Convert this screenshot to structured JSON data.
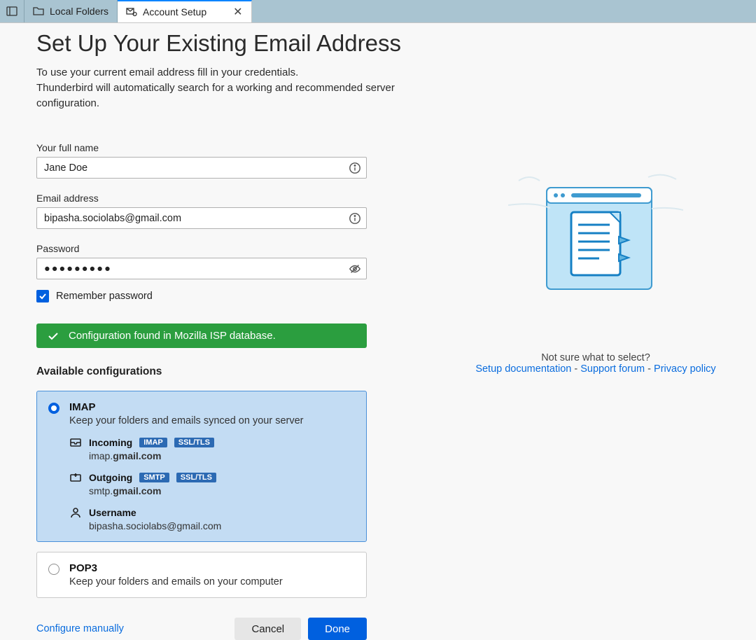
{
  "tabs": {
    "localFolders": "Local Folders",
    "accountSetup": "Account Setup"
  },
  "header": {
    "title": "Set Up Your Existing Email Address",
    "sub1": "To use your current email address fill in your credentials.",
    "sub2": "Thunderbird will automatically search for a working and recommended server configuration."
  },
  "fields": {
    "name_label": "Your full name",
    "name_value": "Jane Doe",
    "email_label": "Email address",
    "email_value": "bipasha.sociolabs@gmail.com",
    "password_label": "Password",
    "password_mask": "●●●●●●●●●",
    "remember_label": "Remember password"
  },
  "banner": "Configuration found in Mozilla ISP database.",
  "avail_heading": "Available configurations",
  "imap": {
    "title": "IMAP",
    "desc": "Keep your folders and emails synced on your server",
    "incoming_label": "Incoming",
    "incoming_badge1": "IMAP",
    "incoming_badge2": "SSL/TLS",
    "incoming_prefix": "imap.",
    "incoming_domain": "gmail.com",
    "outgoing_label": "Outgoing",
    "outgoing_badge1": "SMTP",
    "outgoing_badge2": "SSL/TLS",
    "outgoing_prefix": "smtp.",
    "outgoing_domain": "gmail.com",
    "username_label": "Username",
    "username_value": "bipasha.sociolabs@gmail.com"
  },
  "pop3": {
    "title": "POP3",
    "desc": "Keep your folders and emails on your computer"
  },
  "footer": {
    "manual": "Configure manually",
    "cancel": "Cancel",
    "done": "Done"
  },
  "help": {
    "question": "Not sure what to select?",
    "doc": "Setup documentation",
    "forum": "Support forum",
    "privacy": "Privacy policy",
    "sep": " - "
  }
}
